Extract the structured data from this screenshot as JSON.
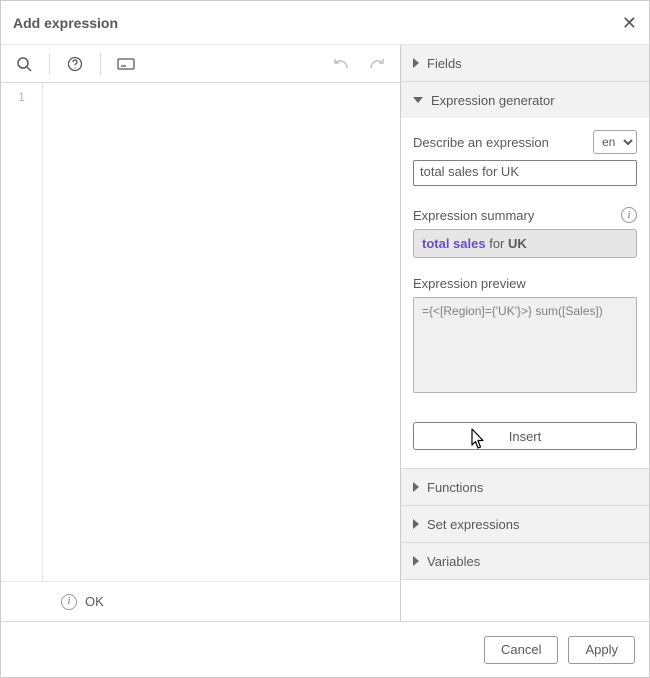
{
  "dialog": {
    "title": "Add expression"
  },
  "editor": {
    "line_number": "1",
    "content": ""
  },
  "status": {
    "text": "OK"
  },
  "right": {
    "fields": {
      "label": "Fields"
    },
    "generator": {
      "label": "Expression generator",
      "describe_label": "Describe an expression",
      "lang": "en",
      "describe_value": "total sales for UK",
      "summary_label": "Expression summary",
      "summary_metric": "total sales",
      "summary_mid": " for ",
      "summary_value": "UK",
      "preview_label": "Expression preview",
      "preview_value": "={<[Region]={'UK'}>} sum([Sales])",
      "insert_label": "Insert"
    },
    "functions": {
      "label": "Functions"
    },
    "set_expressions": {
      "label": "Set expressions"
    },
    "variables": {
      "label": "Variables"
    }
  },
  "footer": {
    "cancel": "Cancel",
    "apply": "Apply"
  }
}
